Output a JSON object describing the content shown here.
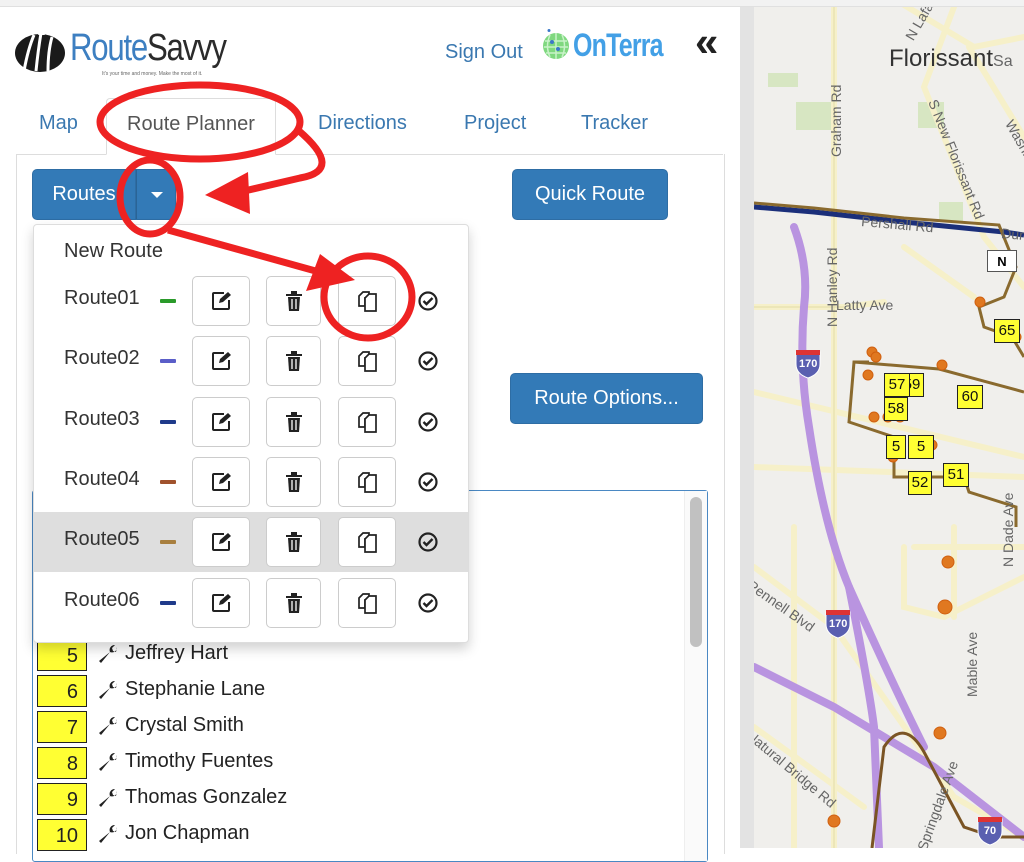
{
  "header": {
    "logo_text_a": "Route",
    "logo_text_b": "Savvy",
    "logo_tagline": "It's your time and money. Make the most of it.",
    "sign_out": "Sign Out",
    "partner_logo": "OnTerra",
    "collapse_icon": "«"
  },
  "tabs": [
    {
      "label": "Map",
      "active": false
    },
    {
      "label": "Route Planner",
      "active": true
    },
    {
      "label": "Directions",
      "active": false
    },
    {
      "label": "Project",
      "active": false
    },
    {
      "label": "Tracker",
      "active": false
    }
  ],
  "toolbar": {
    "routes_label": "Routes",
    "quick_route_label": "Quick Route",
    "route_options_label": "Route Options..."
  },
  "dropdown": {
    "new_route_label": "New Route",
    "routes": [
      {
        "name": "Route01",
        "color": "#2a9a2a",
        "highlighted": false
      },
      {
        "name": "Route02",
        "color": "#5a5ec8",
        "highlighted": false
      },
      {
        "name": "Route03",
        "color": "#1f3a8a",
        "highlighted": false
      },
      {
        "name": "Route04",
        "color": "#a0522d",
        "highlighted": false
      },
      {
        "name": "Route05",
        "color": "#a87f3f",
        "highlighted": true
      },
      {
        "name": "Route06",
        "color": "#1f3a8a",
        "highlighted": false
      }
    ],
    "actions": [
      "edit-icon",
      "trash-icon",
      "copy-icon",
      "check-circle-icon"
    ]
  },
  "stops": [
    {
      "number": "5",
      "name": "Jeffrey Hart"
    },
    {
      "number": "6",
      "name": "Stephanie Lane"
    },
    {
      "number": "7",
      "name": "Crystal Smith"
    },
    {
      "number": "8",
      "name": "Timothy Fuentes"
    },
    {
      "number": "9",
      "name": "Thomas Gonzalez"
    },
    {
      "number": "10",
      "name": "Jon Chapman"
    }
  ],
  "map": {
    "city": "Florissant",
    "city_suffix": "Sa",
    "north_label": "N",
    "streets": [
      "N Lafayette",
      "Graham Rd",
      "S New Florissant Rd",
      "Washington",
      "Pershall Rd",
      "Dunn",
      "N Hanley Rd",
      "Latty Ave",
      "N Dade Ave",
      "Mable Ave",
      "Pennell Blvd",
      "Natural Bridge Rd",
      "Springdale Ave"
    ],
    "highways": [
      "170",
      "170",
      "70"
    ],
    "stop_markers": [
      "65",
      "57",
      "59",
      "58",
      "60",
      "5",
      "5",
      "52",
      "51"
    ]
  },
  "annotations": {
    "color": "#ee2222"
  }
}
